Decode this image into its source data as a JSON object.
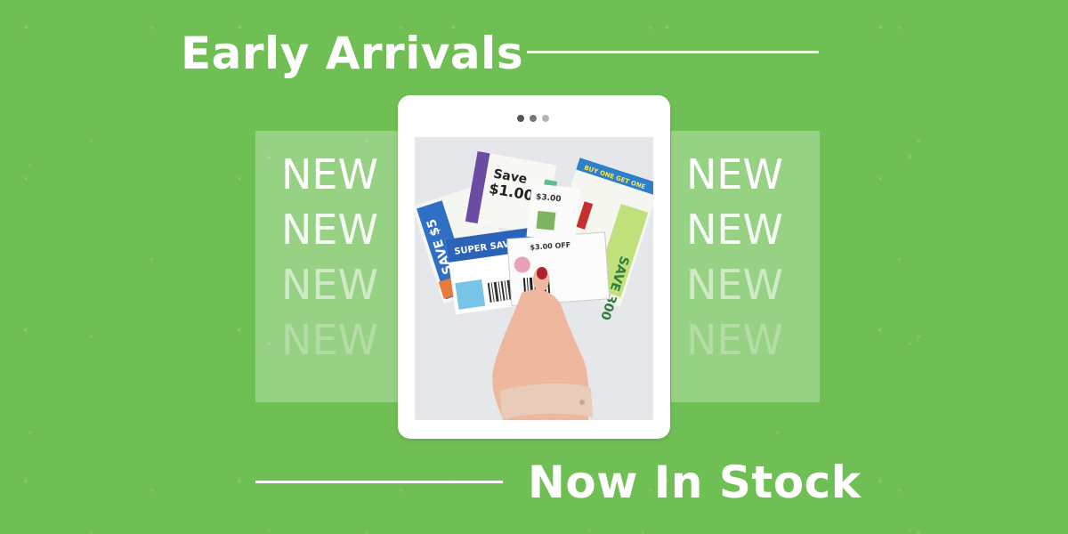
{
  "headline_top": "Early Arrivals",
  "headline_bottom": "Now In Stock",
  "new_word": "NEW",
  "new_left": [
    "NEW",
    "NEW",
    "NEW",
    "NEW"
  ],
  "new_right": [
    "NEW",
    "NEW",
    "NEW",
    "NEW"
  ],
  "coupons": {
    "save_text": "Save",
    "save_amount": "$1.00",
    "super_saver": "SUPER SAVER",
    "three_off": "$3.00 OFF",
    "three_dollars": "$3.00",
    "save_5": "SAVE $5",
    "bogo": "BUY ONE GET ONE",
    "save_300": "SAVE 300"
  },
  "colors": {
    "background": "#70bf55",
    "panel": "rgba(255,255,255,0.28)",
    "tablet": "#ffffff"
  }
}
